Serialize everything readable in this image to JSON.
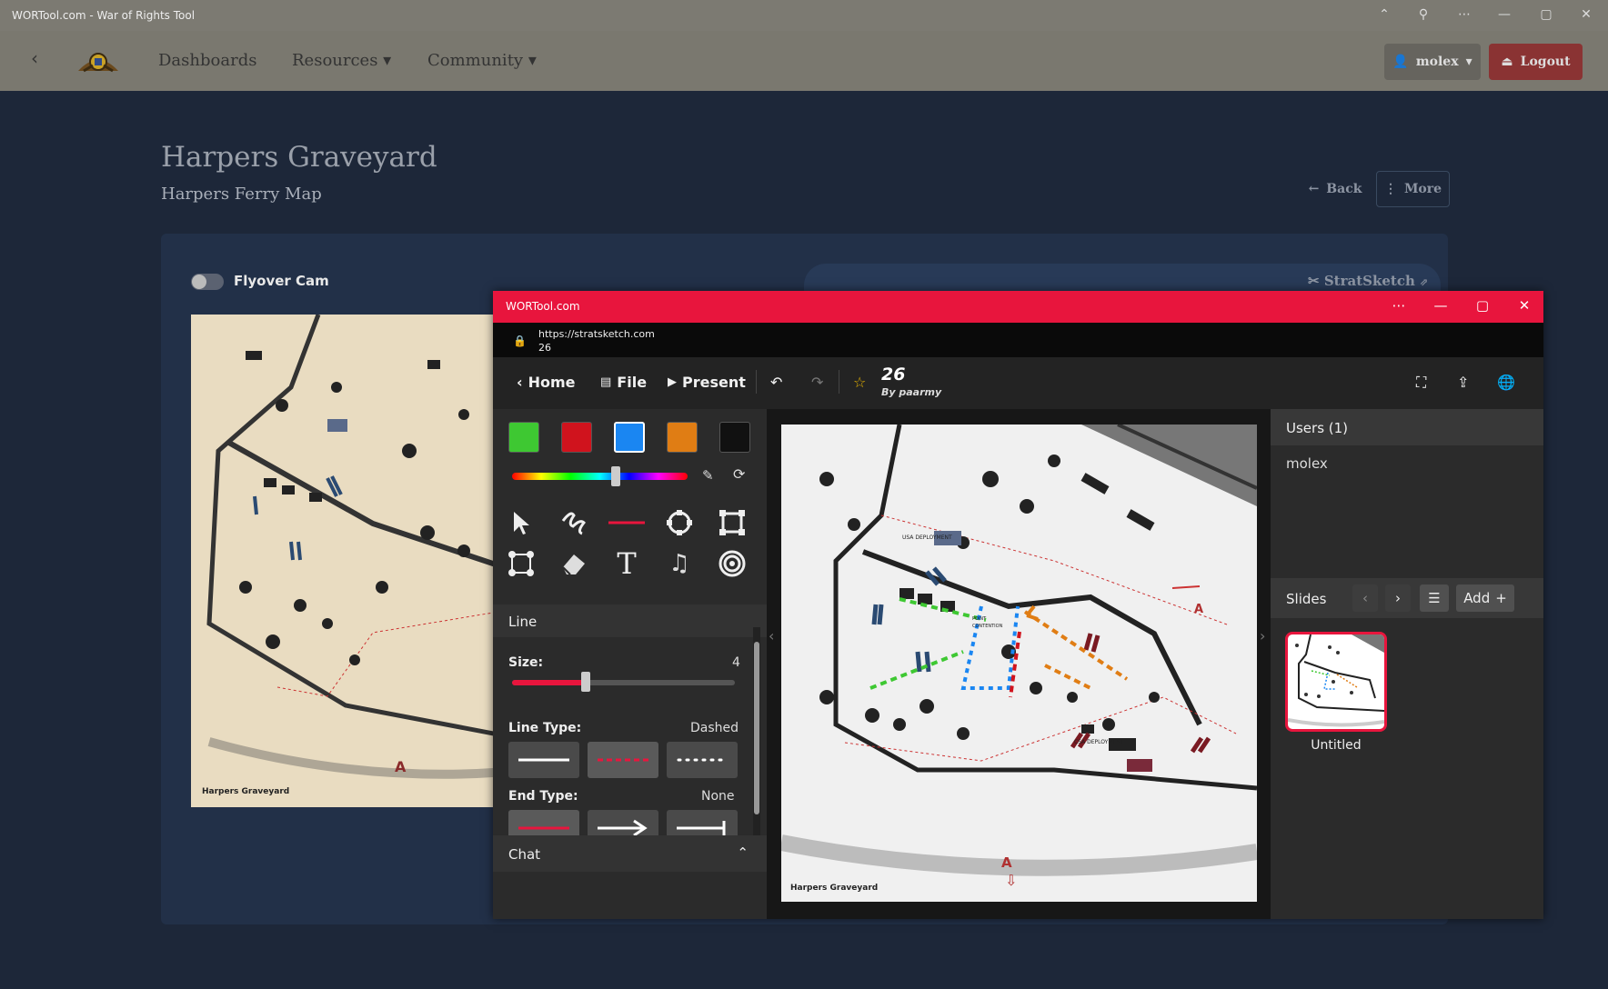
{
  "app": {
    "window_title": "WORTool.com - War of Rights Tool",
    "nav": [
      "Dashboards",
      "Resources",
      "Community"
    ],
    "user_label": "molex",
    "logout_label": "Logout"
  },
  "page": {
    "title": "Harpers Graveyard",
    "subtitle": "Harpers Ferry Map",
    "back_label": "Back",
    "more_label": "More",
    "flyover_label": "Flyover Cam",
    "stratsketch_label": "StratSketch",
    "map_caption": "Harpers Graveyard",
    "marker_letter": "A"
  },
  "popup": {
    "window_title": "WORTool.com",
    "url": "https://stratsketch.com",
    "url_sub": "26",
    "toolbar": {
      "home": "Home",
      "file": "File",
      "present": "Present",
      "sketch_title": "26",
      "sketch_author": "By paarmy"
    },
    "colors": [
      "#3ec832",
      "#d0131d",
      "#1a86f2",
      "#e07d14",
      "#111111"
    ],
    "selected_color_index": 2,
    "hue_slider_value": 0.59,
    "tool_section": "Line",
    "size_label": "Size:",
    "size_value": "4",
    "size_fraction": 0.33,
    "line_type_label": "Line Type:",
    "line_type_value": "Dashed",
    "end_type_label": "End Type:",
    "end_type_value": "None",
    "chat_label": "Chat",
    "users_header": "Users (1)",
    "users": [
      "molex"
    ],
    "slides_label": "Slides",
    "add_label": "Add",
    "slide_name": "Untitled",
    "map_caption": "Harpers Graveyard",
    "map_labels": {
      "deployment": "USA DEPLOYMENT",
      "deployment2": "CSA DEPLOYMENT",
      "point": "POINT",
      "contention": "CONTENTION",
      "marker_a": "A"
    }
  }
}
